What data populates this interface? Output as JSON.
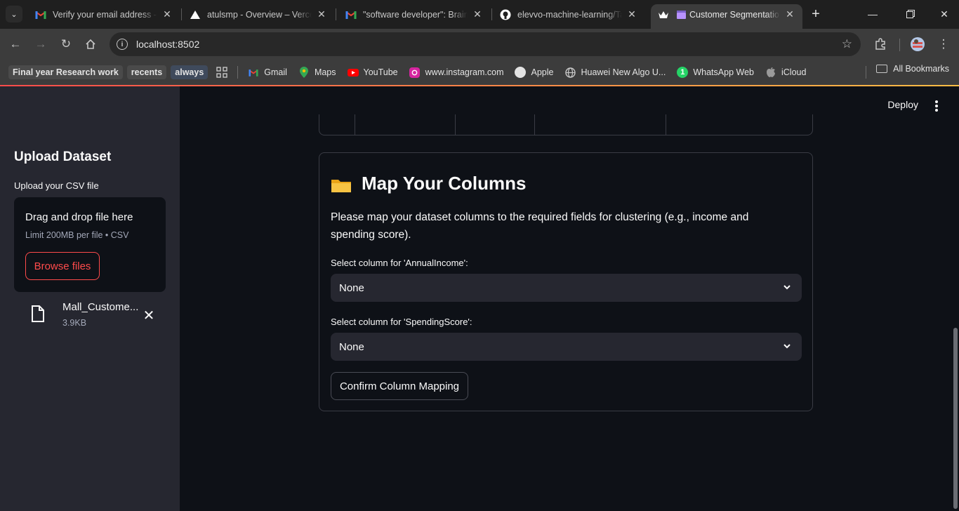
{
  "browser": {
    "tabs": [
      {
        "title": "Verify your email address - c",
        "favicon": "gmail-icon",
        "active": false
      },
      {
        "title": "atulsmp - Overview – Vercel",
        "favicon": "vercel-icon",
        "active": false
      },
      {
        "title": "\"software developer\": Braintr",
        "favicon": "gmail-icon",
        "active": false
      },
      {
        "title": "elevvo-machine-learning/Tas",
        "favicon": "github-icon",
        "active": false
      },
      {
        "title": "Customer Segmentation",
        "favicon": "streamlit-crown-icon",
        "active": true
      }
    ],
    "url": "localhost:8502",
    "bookmarks": [
      {
        "label": "Final year Research work",
        "style": "chip"
      },
      {
        "label": "recents",
        "style": "chip"
      },
      {
        "label": "always",
        "style": "chip-blue"
      },
      {
        "label": "Gmail",
        "icon": "gmail-icon"
      },
      {
        "label": "Maps",
        "icon": "maps-icon"
      },
      {
        "label": "YouTube",
        "icon": "youtube-icon"
      },
      {
        "label": "www.instagram.com",
        "icon": "instagram-icon"
      },
      {
        "label": "Apple",
        "icon": "apple-icon"
      },
      {
        "label": "Huawei New Algo U...",
        "icon": "globe-icon"
      },
      {
        "label": "WhatsApp Web",
        "icon": "whatsapp-icon"
      },
      {
        "label": "iCloud",
        "icon": "apple-icon"
      }
    ],
    "all_bookmarks": "All Bookmarks",
    "accent": "#ff4b4b"
  },
  "sidebar": {
    "title": "Upload Dataset",
    "uploader_label": "Upload your CSV file",
    "dropzone_title": "Drag and drop file here",
    "dropzone_limit": "Limit 200MB per file • CSV",
    "browse_label": "Browse files",
    "file": {
      "name": "Mall_Customers.csv",
      "name_display": "Mall_Custome...",
      "size": "3.9KB"
    }
  },
  "header": {
    "deploy_label": "Deploy"
  },
  "mapping": {
    "emoji": "📁",
    "title": "Map Your Columns",
    "description": "Please map your dataset columns to the required fields for clustering (e.g., income and spending score).",
    "income": {
      "label": "Select column for 'AnnualIncome':",
      "value": "None"
    },
    "spending": {
      "label": "Select column for 'SpendingScore':",
      "value": "None"
    },
    "confirm_label": "Confirm Column Mapping"
  }
}
